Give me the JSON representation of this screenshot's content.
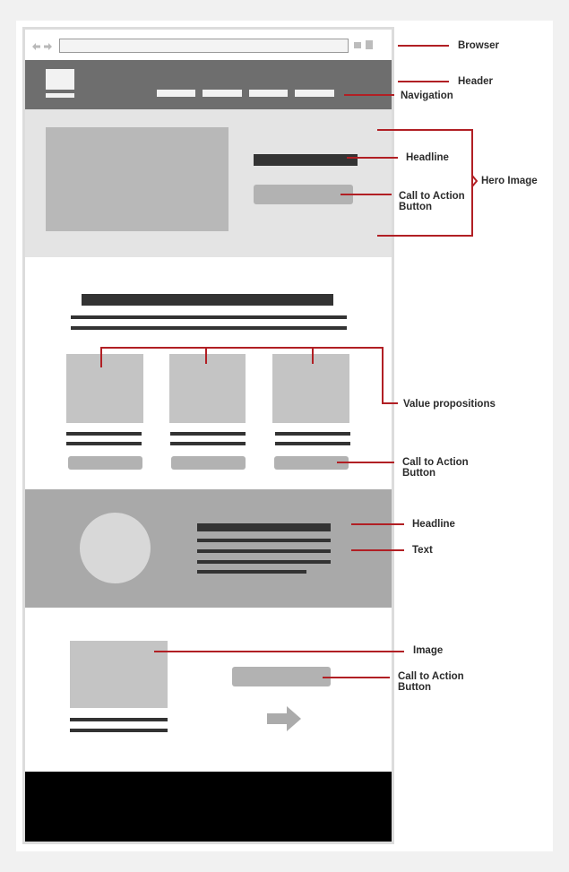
{
  "labels": {
    "browser": "Browser",
    "header": "Header",
    "navigation": "Navigation",
    "headline_1": "Headline",
    "hero_image": "Hero Image",
    "cta_1_line1": "Call to Action",
    "cta_1_line2": "Button",
    "value_propositions": "Value propositions",
    "cta_2_line1": "Call to Action",
    "cta_2_line2": "Button",
    "headline_2": "Headline",
    "text": "Text",
    "image": "Image",
    "cta_3_line1": "Call to Action",
    "cta_3_line2": "Button"
  },
  "colors": {
    "leader_line": "#b11f24",
    "header_bg": "#6e6e6e",
    "hero_bg": "#e4e4e4",
    "band_bg": "#a9a9a9",
    "footer_bg": "#000000",
    "dark_bar": "#333333",
    "placeholder": "#c4c4c4"
  },
  "icons": {
    "browser_arrows": "back-forward-arrows-icon",
    "next_arrow": "arrow-right-icon"
  }
}
